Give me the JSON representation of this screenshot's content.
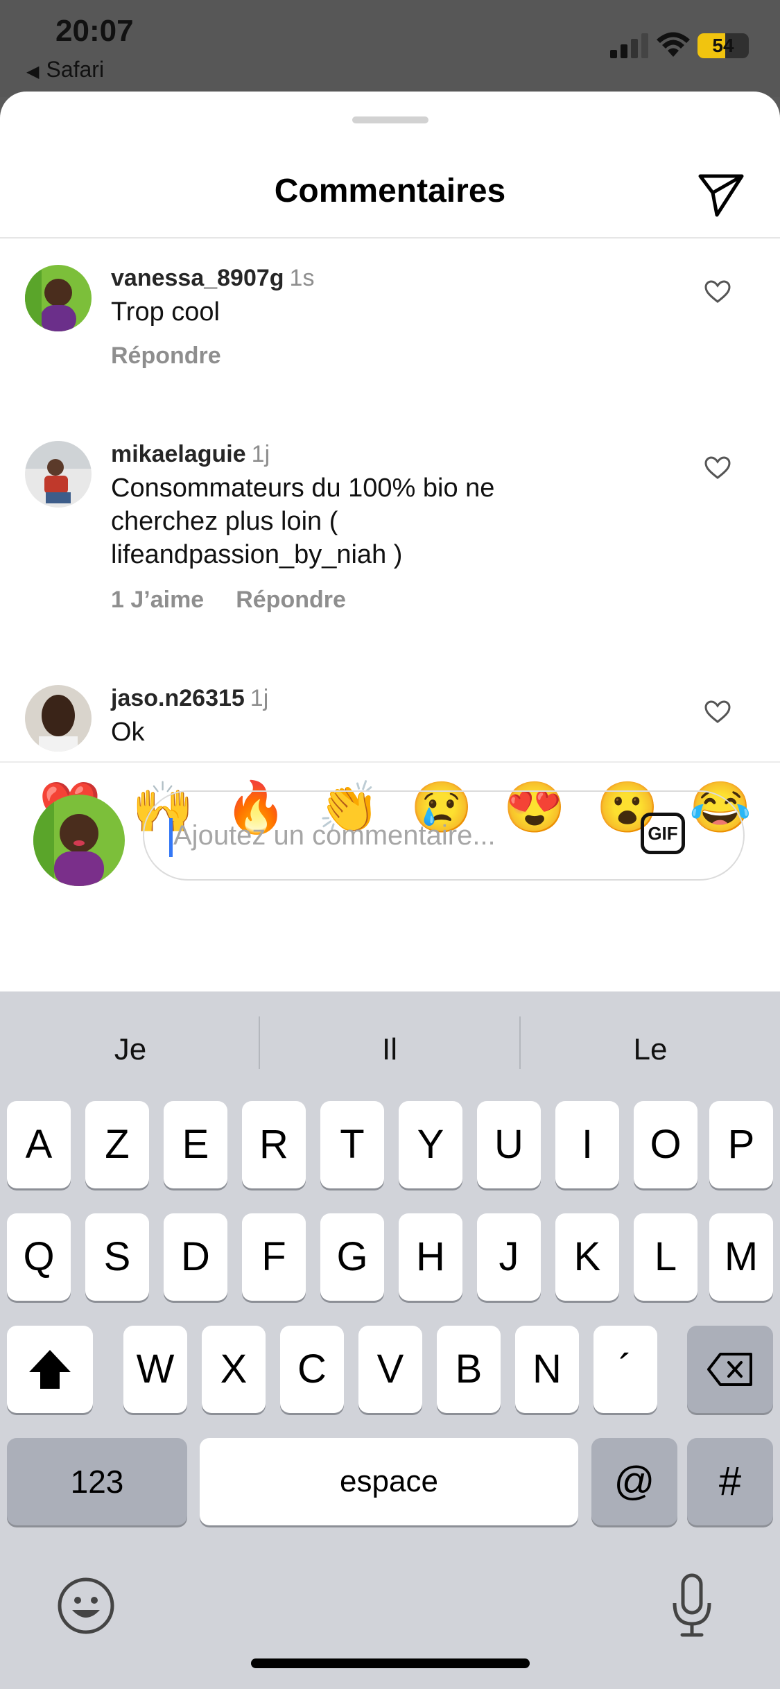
{
  "status_bar": {
    "time": "20:07",
    "back_app": "Safari",
    "battery_level": "54",
    "battery_fraction": 0.54
  },
  "sheet": {
    "title": "Commentaires",
    "share_icon": "send-icon"
  },
  "comments": [
    {
      "username": "vanessa_8907g",
      "time": "1s",
      "text": "Trop cool",
      "actions": [
        "Répondre"
      ]
    },
    {
      "username": "mikaelaguie",
      "time": "1j",
      "text": "Consommateurs du 100% bio ne cherchez plus loin ( lifeandpassion_by_niah )",
      "actions": [
        "1 J’aime",
        "Répondre"
      ]
    },
    {
      "username": "jaso.n26315",
      "time": "1j",
      "text": "Ok",
      "actions": []
    }
  ],
  "quick_reactions": [
    "❤️",
    "🙌",
    "🔥",
    "👏",
    "😢",
    "😍",
    "😮",
    "😂"
  ],
  "composer": {
    "placeholder": "Ajoutez un commentaire...",
    "gif_label": "GIF"
  },
  "keyboard": {
    "suggestions": [
      "Je",
      "Il",
      "Le"
    ],
    "row1": [
      "A",
      "Z",
      "E",
      "R",
      "T",
      "Y",
      "U",
      "I",
      "O",
      "P"
    ],
    "row2": [
      "Q",
      "S",
      "D",
      "F",
      "G",
      "H",
      "J",
      "K",
      "L",
      "M"
    ],
    "row3": [
      "W",
      "X",
      "C",
      "V",
      "B",
      "N",
      "´"
    ],
    "numbers_key": "123",
    "space_key": "espace",
    "at_key": "@",
    "hash_key": "#"
  },
  "colors": {
    "accent_caret": "#3478f6",
    "battery_fill": "#f1c40f",
    "heart_red": "#e0241b"
  }
}
